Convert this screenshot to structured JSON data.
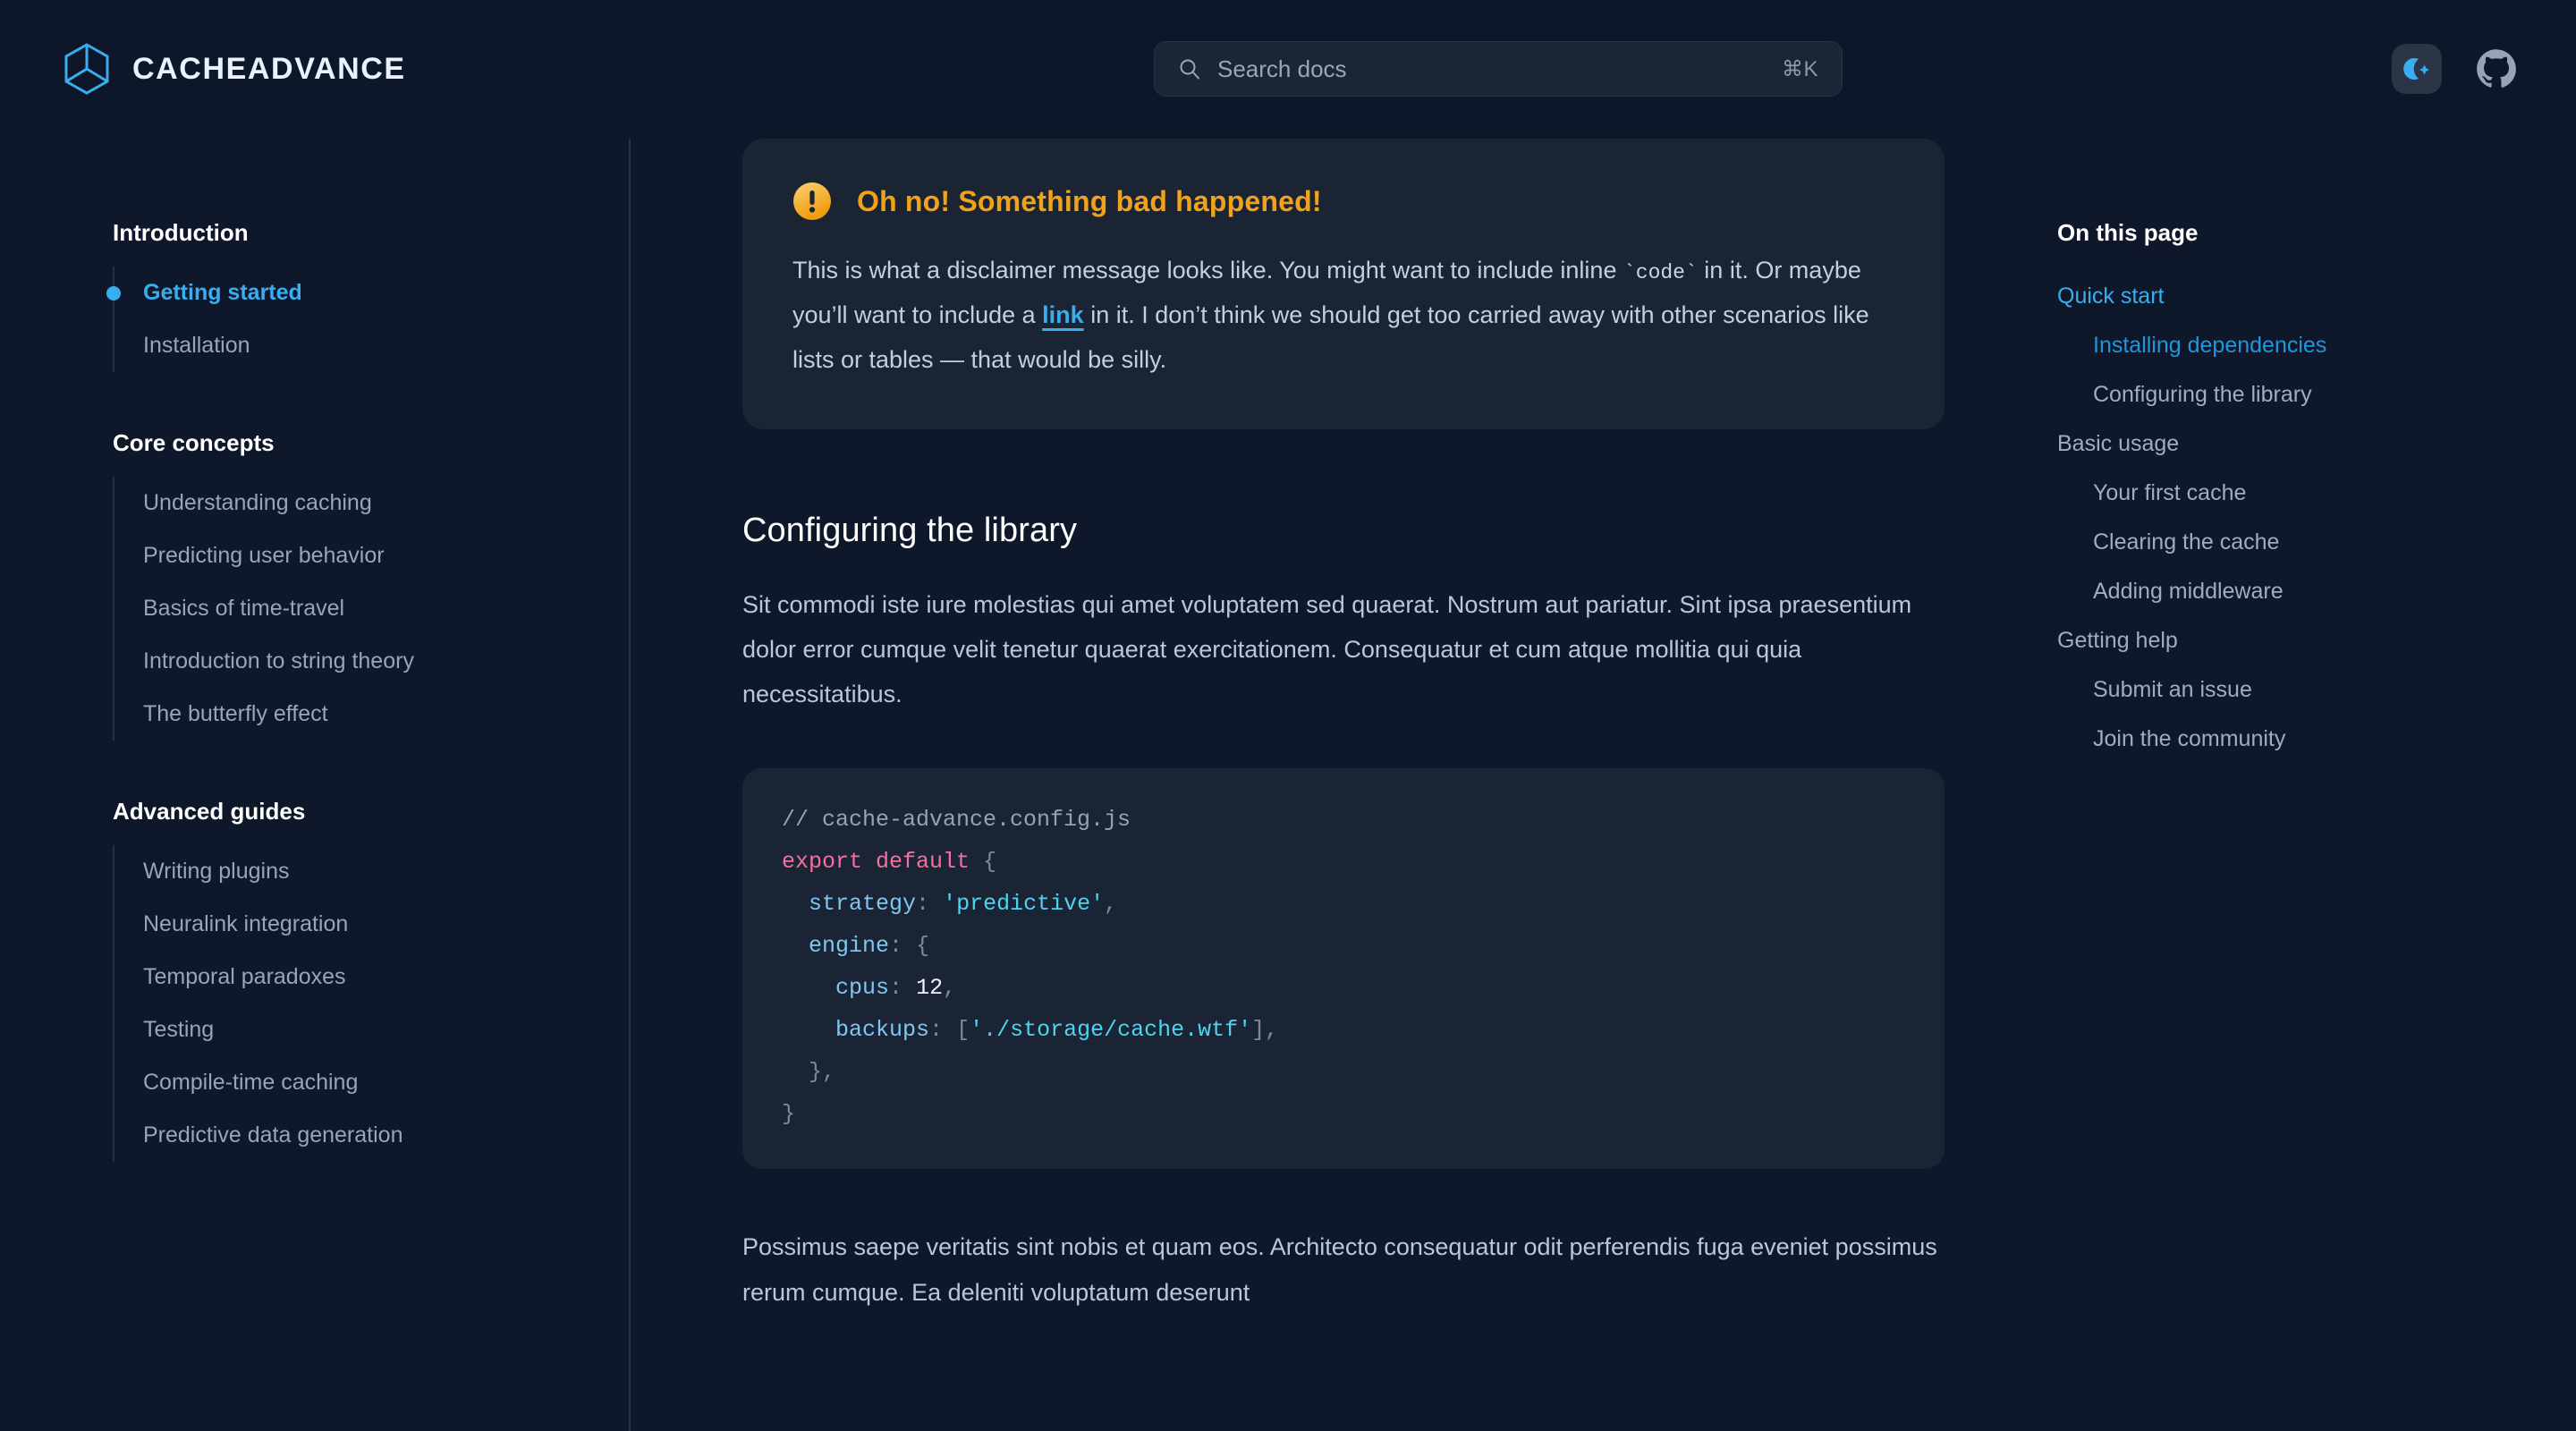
{
  "brand": {
    "name": "CACHEADVANCE",
    "logo_icon": "hexagon-cube-logo-icon",
    "logo_color": "#38aef0"
  },
  "colors": {
    "page_bg": "#0f172a",
    "panel_bg": "#1b2433",
    "accent": "#38aef0",
    "warning": "#f0a21a",
    "body_text": "#bac7d9",
    "muted_text": "#98a5b8"
  },
  "header": {
    "search": {
      "icon": "search-icon",
      "placeholder": "Search docs",
      "value": "",
      "shortcut": "⌘K"
    },
    "theme_toggle": {
      "icon": "moon-sparkle-icon",
      "label": "Toggle dark mode"
    },
    "github": {
      "icon": "github-icon",
      "label": "GitHub"
    }
  },
  "ghost": {
    "text": "consequuntur deserunt voluptatum mollitia quia dolor error sint nobis quam eos architecto odit perferendis fuga eveniet possimus rerum cumque ea deleniti voluptatum"
  },
  "sidebar": {
    "sections": [
      {
        "title": "Introduction",
        "items": [
          {
            "label": "Getting started",
            "active": true
          },
          {
            "label": "Installation",
            "active": false
          }
        ]
      },
      {
        "title": "Core concepts",
        "items": [
          {
            "label": "Understanding caching",
            "active": false
          },
          {
            "label": "Predicting user behavior",
            "active": false
          },
          {
            "label": "Basics of time-travel",
            "active": false
          },
          {
            "label": "Introduction to string theory",
            "active": false
          },
          {
            "label": "The butterfly effect",
            "active": false
          }
        ]
      },
      {
        "title": "Advanced guides",
        "items": [
          {
            "label": "Writing plugins",
            "active": false
          },
          {
            "label": "Neuralink integration",
            "active": false
          },
          {
            "label": "Temporal paradoxes",
            "active": false
          },
          {
            "label": "Testing",
            "active": false
          },
          {
            "label": "Compile-time caching",
            "active": false
          },
          {
            "label": "Predictive data generation",
            "active": false
          }
        ]
      }
    ]
  },
  "callout": {
    "icon": "warning-exclamation-icon",
    "title": "Oh no! Something bad happened!",
    "body_part1": "This is what a disclaimer message looks like. You might want to include inline ",
    "body_code": "`code`",
    "body_part2": " in it. Or maybe you’ll want to include a ",
    "body_link": "link",
    "body_part3": " in it. I don’t think we should get too carried away with other scenarios like lists or tables — that would be silly."
  },
  "main": {
    "heading": "Configuring the library",
    "paragraph1": "Sit commodi iste iure molestias qui amet voluptatem sed quaerat. Nostrum aut pariatur. Sint ipsa praesentium dolor error cumque velit tenetur quaerat exercitationem. Consequatur et cum atque mollitia qui quia necessitatibus.",
    "paragraph2": "Possimus saepe veritatis sint nobis et quam eos. Architecto consequatur odit perferendis fuga eveniet possimus rerum cumque. Ea deleniti voluptatum deserunt",
    "code": {
      "filename_comment": "// cache-advance.config.js",
      "lines": [
        "// cache-advance.config.js",
        "export default {",
        "  strategy: 'predictive',",
        "  engine: {",
        "    cpus: 12,",
        "    backups: ['./storage/cache.wtf'],",
        "  },",
        "}"
      ],
      "values": {
        "strategy": "predictive",
        "cpus": "12",
        "backups": "./storage/cache.wtf"
      }
    }
  },
  "toc": {
    "title": "On this page",
    "items": [
      {
        "label": "Quick start",
        "level": 1,
        "active": true
      },
      {
        "label": "Installing dependencies",
        "level": 2,
        "active": true
      },
      {
        "label": "Configuring the library",
        "level": 2,
        "active": false
      },
      {
        "label": "Basic usage",
        "level": 1,
        "active": false
      },
      {
        "label": "Your first cache",
        "level": 2,
        "active": false
      },
      {
        "label": "Clearing the cache",
        "level": 2,
        "active": false
      },
      {
        "label": "Adding middleware",
        "level": 2,
        "active": false
      },
      {
        "label": "Getting help",
        "level": 1,
        "active": false
      },
      {
        "label": "Submit an issue",
        "level": 2,
        "active": false
      },
      {
        "label": "Join the community",
        "level": 2,
        "active": false
      }
    ]
  }
}
